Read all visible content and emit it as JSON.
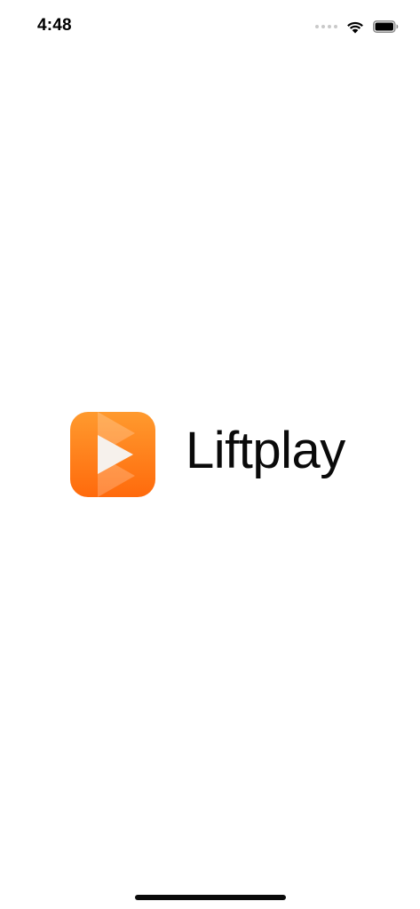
{
  "status_bar": {
    "time": "4:48",
    "icons": [
      "cellular-signal-icon",
      "wifi-icon",
      "battery-icon"
    ]
  },
  "splash": {
    "app_name": "Liftplay",
    "icon": "liftplay-play-logo-icon",
    "brand_colors": {
      "gradient_top": "#ff9a2e",
      "gradient_bottom": "#ff6a0c",
      "text": "#0a0a0a"
    }
  }
}
